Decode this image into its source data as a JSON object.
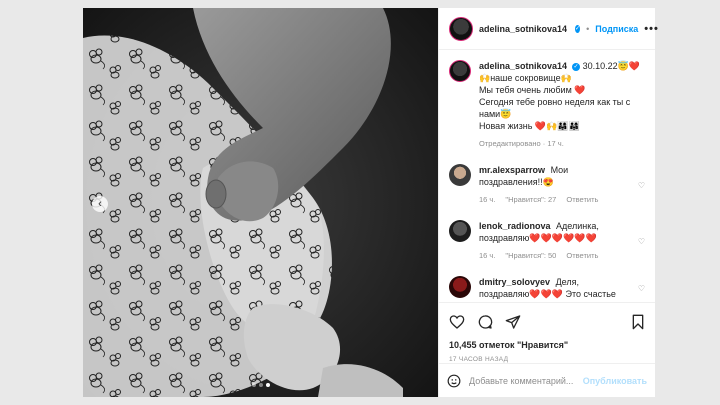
{
  "post": {
    "username": "adelina_sotnikova14",
    "follow_label": "Подписка",
    "separator": "•",
    "more_label": "•••",
    "caption": {
      "username": "adelina_sotnikova14",
      "line1": "30.10.22😇❤️",
      "line2": "🙌наше сокровище🙌",
      "line3": "Мы тебя очень любим ❤️",
      "line4": "Сегодня тебе ровно неделя как ты с нами😇",
      "line5": "Новая жизнь ❤️🙌👨‍👩‍👧👨‍👩‍👧",
      "edited": "Отредактировано · 17 ч."
    },
    "comments": [
      {
        "username": "mr.alexsparrow",
        "text": "Мои поздравления!!😍",
        "time": "16 ч.",
        "likes": "\"Нравится\": 27",
        "reply": "Ответить"
      },
      {
        "username": "lenok_radionova",
        "text": "Аделинка, поздравляю❤️❤️❤️❤️❤️❤️",
        "time": "16 ч.",
        "likes": "\"Нравится\": 50",
        "reply": "Ответить"
      },
      {
        "username": "dmitry_solovyev",
        "text": "Деля, поздравляю❤️❤️❤️ Это счастье",
        "time": "",
        "likes": "",
        "reply": ""
      }
    ],
    "likes_text": "10,455 отметок \"Нравится\"",
    "time_ago": "17 ЧАСОВ НАЗАД",
    "comment_placeholder": "Добавьте комментарий...",
    "publish_label": "Опубликовать",
    "carousel": {
      "current": 3,
      "total": 3,
      "prev_icon": "‹"
    }
  }
}
